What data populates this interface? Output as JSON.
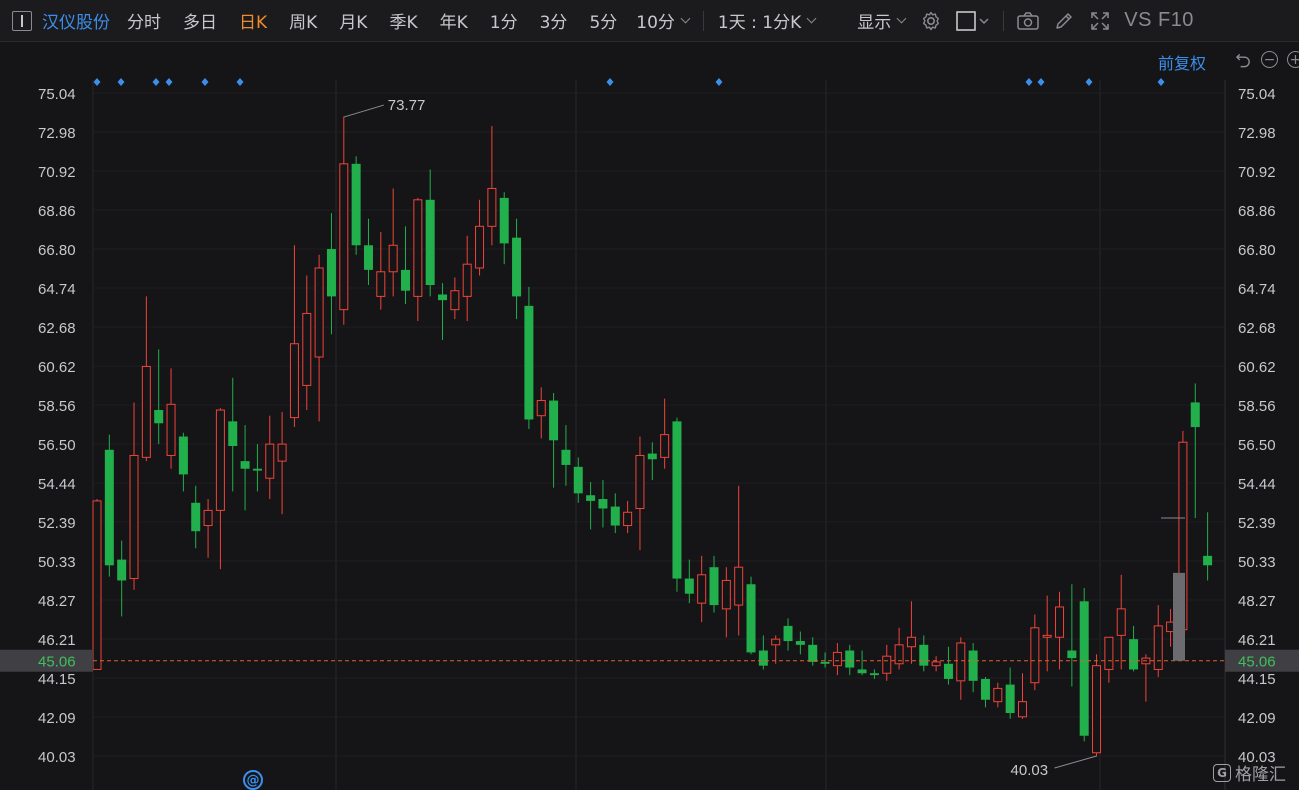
{
  "toolbar": {
    "stock_name": "汉仪股份",
    "tabs": [
      {
        "label": "分时",
        "active": false
      },
      {
        "label": "多日",
        "active": false
      },
      {
        "label": "日K",
        "active": true
      },
      {
        "label": "周K",
        "active": false
      },
      {
        "label": "月K",
        "active": false
      },
      {
        "label": "季K",
        "active": false
      },
      {
        "label": "年K",
        "active": false
      },
      {
        "label": "1分",
        "active": false
      },
      {
        "label": "3分",
        "active": false
      },
      {
        "label": "5分",
        "active": false
      }
    ],
    "more_tab": "10分",
    "period_select": "1天 : 1分K",
    "display_select": "显示",
    "vs_f10": "VS F10"
  },
  "adjust_label": "前复权",
  "current_price_label": "45.06",
  "brand": {
    "mark": "G",
    "name": "格隆汇"
  },
  "colors": {
    "up": "#f0433a",
    "down": "#21b04b",
    "accent": "#3b8eea",
    "active_tab": "#ef8b2c",
    "bg": "#151517",
    "dashed_line": "#e0602d"
  },
  "icons": [
    "settings-icon",
    "checkbox-icon",
    "camera-icon",
    "pencil-icon",
    "fullscreen-icon",
    "undo-icon",
    "zoom-out-icon",
    "zoom-in-icon",
    "at-icon"
  ],
  "chart_data": {
    "type": "candlestick",
    "y_ticks": [
      75.04,
      72.98,
      70.92,
      68.86,
      66.8,
      64.74,
      62.68,
      60.62,
      58.56,
      56.5,
      54.44,
      52.39,
      50.33,
      48.27,
      46.21,
      44.15,
      42.09,
      40.03
    ],
    "ylim": [
      39.0,
      76.5
    ],
    "current_price": 45.06,
    "high_annotation": "73.77",
    "low_annotation": "40.03",
    "event_marker_count": 12,
    "grid": true,
    "candles": [
      [
        44.6,
        53.5,
        45.0,
        53.6
      ],
      [
        56.2,
        50.1,
        49.5,
        57.0
      ],
      [
        50.4,
        49.3,
        47.4,
        51.4
      ],
      [
        49.4,
        55.9,
        48.8,
        58.7
      ],
      [
        55.8,
        60.6,
        55.6,
        64.3
      ],
      [
        58.3,
        57.6,
        56.5,
        61.5
      ],
      [
        55.9,
        58.6,
        55.2,
        60.5
      ],
      [
        56.9,
        54.9,
        54.0,
        57.1
      ],
      [
        53.4,
        51.9,
        51.0,
        54.3
      ],
      [
        52.2,
        53.0,
        50.5,
        53.6
      ],
      [
        53.0,
        58.3,
        49.9,
        58.4
      ],
      [
        57.7,
        56.4,
        54.0,
        60.0
      ],
      [
        55.6,
        55.2,
        53.0,
        57.5
      ],
      [
        55.2,
        55.1,
        54.0,
        56.5
      ],
      [
        54.7,
        56.5,
        53.6,
        58.0
      ],
      [
        55.6,
        56.5,
        52.8,
        58.2
      ],
      [
        57.9,
        61.8,
        57.4,
        67.0
      ],
      [
        59.6,
        63.4,
        58.3,
        65.4
      ],
      [
        61.1,
        65.8,
        57.7,
        66.5
      ],
      [
        66.8,
        64.3,
        62.3,
        68.7
      ],
      [
        63.6,
        71.3,
        62.8,
        73.8
      ],
      [
        71.3,
        67.0,
        66.5,
        71.7
      ],
      [
        67.0,
        65.7,
        64.9,
        68.4
      ],
      [
        64.3,
        65.6,
        63.6,
        67.7
      ],
      [
        65.6,
        67.0,
        64.3,
        70.0
      ],
      [
        65.7,
        64.6,
        63.9,
        68.0
      ],
      [
        64.3,
        69.4,
        63.0,
        69.5
      ],
      [
        69.4,
        64.9,
        64.3,
        71.0
      ],
      [
        64.4,
        64.1,
        62.0,
        65.0
      ],
      [
        63.6,
        64.6,
        63.1,
        65.3
      ],
      [
        64.3,
        66.0,
        63.0,
        67.5
      ],
      [
        65.8,
        68.0,
        65.4,
        69.4
      ],
      [
        68.0,
        70.0,
        67.0,
        73.3
      ],
      [
        69.5,
        67.1,
        66.0,
        69.8
      ],
      [
        67.4,
        64.3,
        63.1,
        68.4
      ],
      [
        63.8,
        57.8,
        57.3,
        64.8
      ],
      [
        58.0,
        58.8,
        56.8,
        59.5
      ],
      [
        58.8,
        56.7,
        54.2,
        59.2
      ],
      [
        56.2,
        55.4,
        54.3,
        57.5
      ],
      [
        55.3,
        53.9,
        53.4,
        55.8
      ],
      [
        53.8,
        53.5,
        52.0,
        54.5
      ],
      [
        53.6,
        53.1,
        52.1,
        54.6
      ],
      [
        53.2,
        52.2,
        51.8,
        53.9
      ],
      [
        52.2,
        52.9,
        51.8,
        53.5
      ],
      [
        53.1,
        55.9,
        50.9,
        56.9
      ],
      [
        56.0,
        55.7,
        54.6,
        56.6
      ],
      [
        55.8,
        57.0,
        55.2,
        58.9
      ],
      [
        57.7,
        49.4,
        48.7,
        57.9
      ],
      [
        49.4,
        48.6,
        48.1,
        50.4
      ],
      [
        48.1,
        49.6,
        47.1,
        50.6
      ],
      [
        50.0,
        48.0,
        47.6,
        50.6
      ],
      [
        47.8,
        49.3,
        46.3,
        50.0
      ],
      [
        48.0,
        50.0,
        46.4,
        54.3
      ],
      [
        49.1,
        45.5,
        45.4,
        49.5
      ],
      [
        45.6,
        44.8,
        44.6,
        46.4
      ],
      [
        45.9,
        46.2,
        44.9,
        46.4
      ],
      [
        46.9,
        46.1,
        45.6,
        47.3
      ],
      [
        46.1,
        45.9,
        45.4,
        46.6
      ],
      [
        45.9,
        45.0,
        44.8,
        46.3
      ],
      [
        45.0,
        44.9,
        44.7,
        45.5
      ],
      [
        44.8,
        45.5,
        44.3,
        46.0
      ],
      [
        45.6,
        44.7,
        44.3,
        45.9
      ],
      [
        44.6,
        44.4,
        44.3,
        45.6
      ],
      [
        44.4,
        44.3,
        44.1,
        44.6
      ],
      [
        44.4,
        45.3,
        44.0,
        45.9
      ],
      [
        44.9,
        45.9,
        44.6,
        46.8
      ],
      [
        45.8,
        46.3,
        44.9,
        48.2
      ],
      [
        45.9,
        44.8,
        44.5,
        46.4
      ],
      [
        44.8,
        45.0,
        44.5,
        45.3
      ],
      [
        44.9,
        44.1,
        43.8,
        45.8
      ],
      [
        44.0,
        46.0,
        43.0,
        46.3
      ],
      [
        45.6,
        44.0,
        43.4,
        46.0
      ],
      [
        44.1,
        43.0,
        42.6,
        44.2
      ],
      [
        42.9,
        43.6,
        42.6,
        43.9
      ],
      [
        43.8,
        42.3,
        42.0,
        44.7
      ],
      [
        42.1,
        42.9,
        42.0,
        44.4
      ],
      [
        43.9,
        46.8,
        43.5,
        47.5
      ],
      [
        46.3,
        46.4,
        44.5,
        48.5
      ],
      [
        46.3,
        47.9,
        44.6,
        48.7
      ],
      [
        45.6,
        45.2,
        43.7,
        49.1
      ],
      [
        48.2,
        41.1,
        40.8,
        48.9
      ],
      [
        40.2,
        44.8,
        40.0,
        45.4
      ],
      [
        44.6,
        46.3,
        43.9,
        46.3
      ],
      [
        46.4,
        47.8,
        44.6,
        49.6
      ],
      [
        46.2,
        44.6,
        44.5,
        46.9
      ],
      [
        44.9,
        45.2,
        42.9,
        45.4
      ],
      [
        44.6,
        46.9,
        44.2,
        48.0
      ],
      [
        46.6,
        47.1,
        45.8,
        47.8
      ],
      [
        46.7,
        56.6,
        46.4,
        57.2
      ],
      [
        58.7,
        57.4,
        52.6,
        59.7
      ],
      [
        50.6,
        50.1,
        49.3,
        52.9
      ]
    ]
  }
}
